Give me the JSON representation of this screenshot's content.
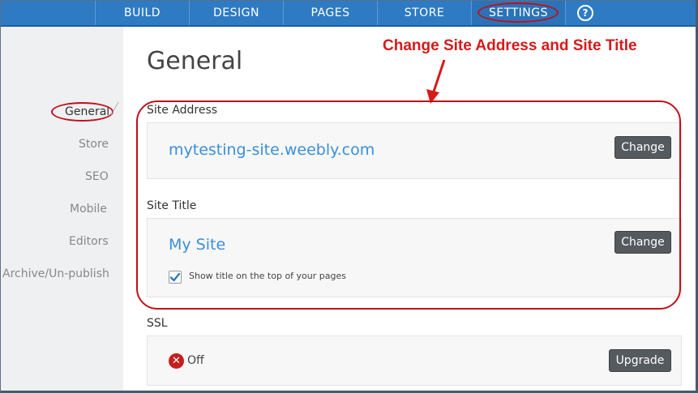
{
  "topnav": {
    "items": [
      {
        "label": "BUILD"
      },
      {
        "label": "DESIGN"
      },
      {
        "label": "PAGES"
      },
      {
        "label": "STORE"
      },
      {
        "label": "SETTINGS"
      }
    ],
    "help_glyph": "?",
    "help_icon": "question-circle-icon",
    "active": "SETTINGS"
  },
  "sidebar": {
    "items": [
      {
        "label": "General"
      },
      {
        "label": "Store"
      },
      {
        "label": "SEO"
      },
      {
        "label": "Mobile"
      },
      {
        "label": "Editors"
      },
      {
        "label": "Archive/Un-publish"
      }
    ],
    "active": "General"
  },
  "main": {
    "title": "General",
    "site_address": {
      "label": "Site Address",
      "value": "mytesting-site.weebly.com",
      "button": "Change"
    },
    "site_title": {
      "label": "Site Title",
      "value": "My Site",
      "button": "Change",
      "checkbox_label": "Show title on the top of your pages",
      "checkbox_checked": true
    },
    "ssl": {
      "label": "SSL",
      "status": "Off",
      "status_icon": "x-circle-icon",
      "button": "Upgrade"
    }
  },
  "annotation": {
    "text": "Change Site Address and Site Title",
    "color": "#d61a1a"
  },
  "colors": {
    "nav_bg": "#2e7bc3",
    "link": "#3a8fd9",
    "button_bg": "#555a5f",
    "highlight_ring": "#c0101a"
  }
}
